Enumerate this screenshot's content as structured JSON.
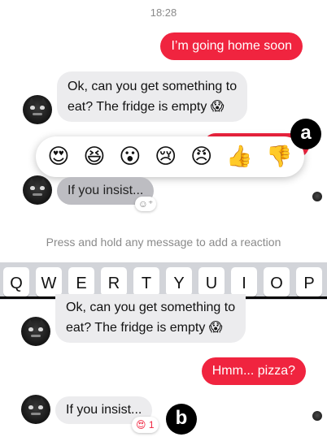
{
  "time": "18:28",
  "top_panel": {
    "outgoing_1": "I’m going home soon",
    "incoming_1_line1": "Ok, can you get something to",
    "incoming_1_line2": "eat? The fridge is empty 😱",
    "reactions": [
      "😍",
      "😆",
      "😮",
      "😢",
      "😠",
      "👍",
      "👎"
    ],
    "label_a": "a",
    "incoming_2": "If you insist...",
    "add_reaction_icon": "☺⁺"
  },
  "hint": "Press and hold any message to add a reaction",
  "keyboard": {
    "keys": [
      "Q",
      "W",
      "E",
      "R",
      "T",
      "Y",
      "U",
      "I",
      "O",
      "P"
    ]
  },
  "bottom_panel": {
    "incoming_1_line1": "Ok, can you get something to",
    "incoming_1_line2": "eat? The fridge is empty 😱",
    "outgoing_1": "Hmm... pizza?",
    "incoming_2": "If you insist...",
    "reaction_emoji": "😍",
    "reaction_count": "1",
    "label_b": "b"
  },
  "colors": {
    "outgoing_bubble": "#f0243f",
    "incoming_bubble": "#ececee",
    "dimmed_bubble": "#bdbdc2"
  }
}
